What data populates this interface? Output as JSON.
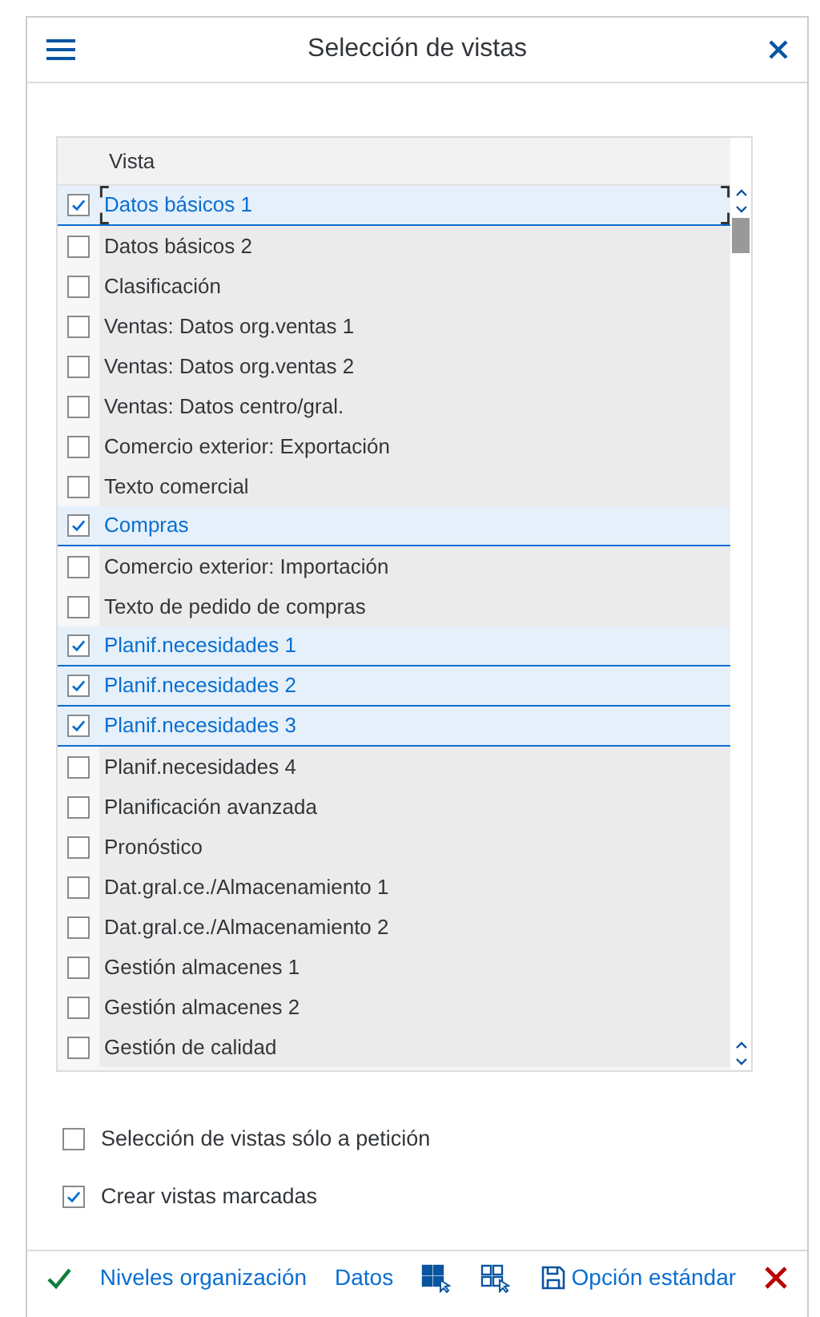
{
  "dialog": {
    "title": "Selección de vistas"
  },
  "table": {
    "columns": [
      "Vista"
    ],
    "rows": [
      {
        "label": "Datos básicos 1",
        "checked": true,
        "selected": true,
        "focused": true
      },
      {
        "label": "Datos básicos 2",
        "checked": false,
        "selected": false,
        "focused": false
      },
      {
        "label": "Clasificación",
        "checked": false,
        "selected": false,
        "focused": false
      },
      {
        "label": "Ventas: Datos org.ventas 1",
        "checked": false,
        "selected": false,
        "focused": false
      },
      {
        "label": "Ventas: Datos org.ventas 2",
        "checked": false,
        "selected": false,
        "focused": false
      },
      {
        "label": "Ventas: Datos centro/gral.",
        "checked": false,
        "selected": false,
        "focused": false
      },
      {
        "label": "Comercio exterior: Exportación",
        "checked": false,
        "selected": false,
        "focused": false
      },
      {
        "label": "Texto comercial",
        "checked": false,
        "selected": false,
        "focused": false
      },
      {
        "label": "Compras",
        "checked": true,
        "selected": true,
        "focused": false
      },
      {
        "label": "Comercio exterior: Importación",
        "checked": false,
        "selected": false,
        "focused": false
      },
      {
        "label": "Texto de pedido de compras",
        "checked": false,
        "selected": false,
        "focused": false
      },
      {
        "label": "Planif.necesidades 1",
        "checked": true,
        "selected": true,
        "focused": false
      },
      {
        "label": "Planif.necesidades 2",
        "checked": true,
        "selected": true,
        "focused": false
      },
      {
        "label": "Planif.necesidades 3",
        "checked": true,
        "selected": true,
        "focused": false
      },
      {
        "label": "Planif.necesidades 4",
        "checked": false,
        "selected": false,
        "focused": false
      },
      {
        "label": "Planificación avanzada",
        "checked": false,
        "selected": false,
        "focused": false
      },
      {
        "label": "Pronóstico",
        "checked": false,
        "selected": false,
        "focused": false
      },
      {
        "label": "Dat.gral.ce./Almacenamiento 1",
        "checked": false,
        "selected": false,
        "focused": false
      },
      {
        "label": "Dat.gral.ce./Almacenamiento 2",
        "checked": false,
        "selected": false,
        "focused": false
      },
      {
        "label": "Gestión almacenes 1",
        "checked": false,
        "selected": false,
        "focused": false
      },
      {
        "label": "Gestión almacenes 2",
        "checked": false,
        "selected": false,
        "focused": false
      },
      {
        "label": "Gestión de calidad",
        "checked": false,
        "selected": false,
        "focused": false
      }
    ]
  },
  "options": [
    {
      "label": "Selección de vistas sólo a petición",
      "checked": false
    },
    {
      "label": "Crear vistas marcadas",
      "checked": true
    }
  ],
  "toolbar": [
    {
      "kind": "confirm"
    },
    {
      "kind": "text",
      "label": "Niveles organización"
    },
    {
      "kind": "text",
      "label": "Datos"
    },
    {
      "kind": "select-all"
    },
    {
      "kind": "deselect-all"
    },
    {
      "kind": "save",
      "label": "Opción estándar"
    },
    {
      "kind": "cancel"
    }
  ]
}
